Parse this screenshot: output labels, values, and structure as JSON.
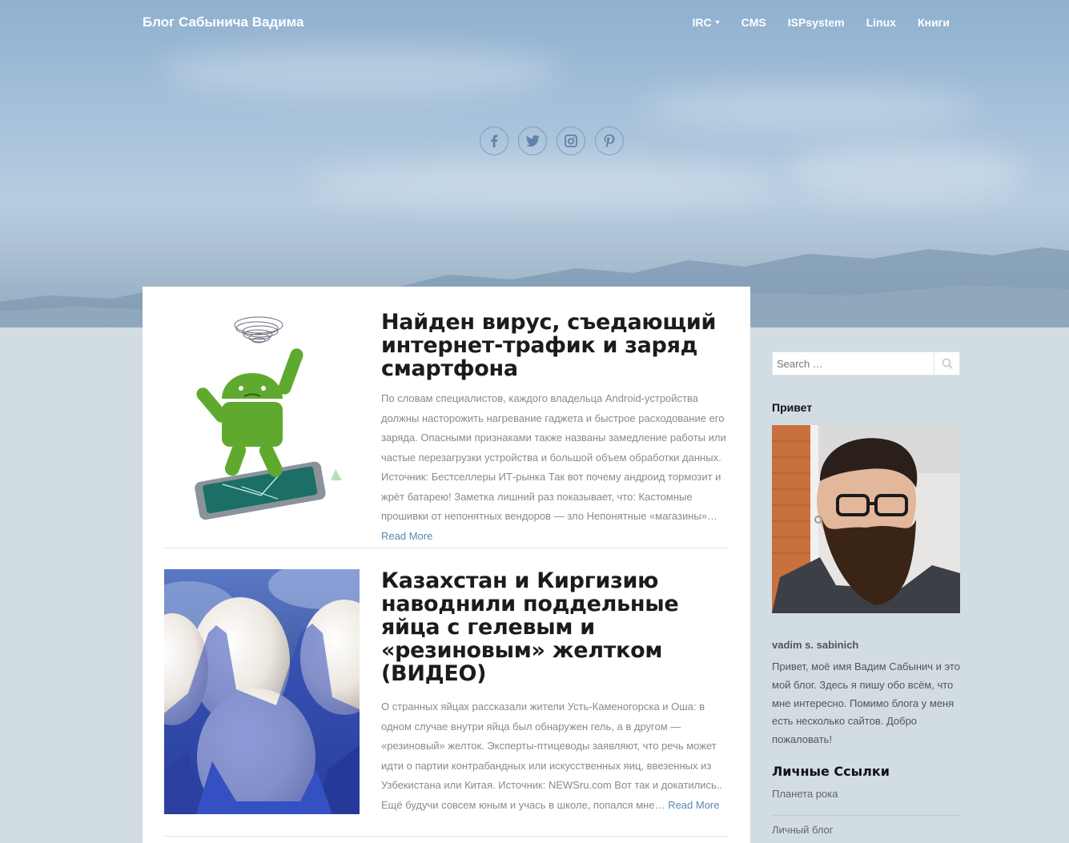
{
  "site": {
    "title": "Блог Сабынича Вадима"
  },
  "nav": {
    "items": [
      {
        "label": "IRC",
        "has_dropdown": true
      },
      {
        "label": "CMS"
      },
      {
        "label": "ISPsystem"
      },
      {
        "label": "Linux"
      },
      {
        "label": "Книги"
      }
    ]
  },
  "social": [
    "facebook-icon",
    "twitter-icon",
    "instagram-icon",
    "pinterest-icon"
  ],
  "posts": [
    {
      "title": "Найден вирус, съедающий интернет-трафик и заряд смартфона",
      "excerpt": "По словам специалистов, каждого владельца Android-устройства должны насторожить нагревание гаджета и быстрое расходование его заряда. Опасными признаками также названы замедление работы или частые перезагрузки устройства и большой объем обработки данных. Источник: Бестселлеры ИТ-рынка Так вот почему андроид тормозит и жрёт батарею! Заметка лишний раз показывает, что: Кастомные прошивки от непонятных вендоров — зло Непонятные «магазины»…",
      "read_more": "Read More"
    },
    {
      "title": "Казахстан и Киргизию наводнили поддельные яйца с гелевым и «резиновым» желтком (ВИДЕО)",
      "excerpt": "О странных яйцах рассказали жители Усть-Каменогорска и Оша: в одном случае внутри яйца был обнаружен гель, а в другом — «резиновый» желток. Эксперты-птицеводы заявляют, что речь может идти о партии контрабандных или искусственных яиц, ввезенных из Узбекистана или Китая. Источник: NEWSru.com Вот так и докатились.. Ещё будучи совсем юным и учась в школе, попался мне…",
      "read_more": "Read More"
    }
  ],
  "sidebar": {
    "search_placeholder": "Search …",
    "about_title": "Привет",
    "bio_name": "vadim s. sabinich",
    "bio_text": "Привет, моё имя Вадим Сабынич и это мой блог. Здесь я пишу обо всём, что мне интересно. Помимо блога у меня есть несколько сайтов. Добро пожаловать!",
    "links_title": "Личные Ссылки",
    "links": [
      "Планета рока",
      "Личный блог"
    ]
  }
}
